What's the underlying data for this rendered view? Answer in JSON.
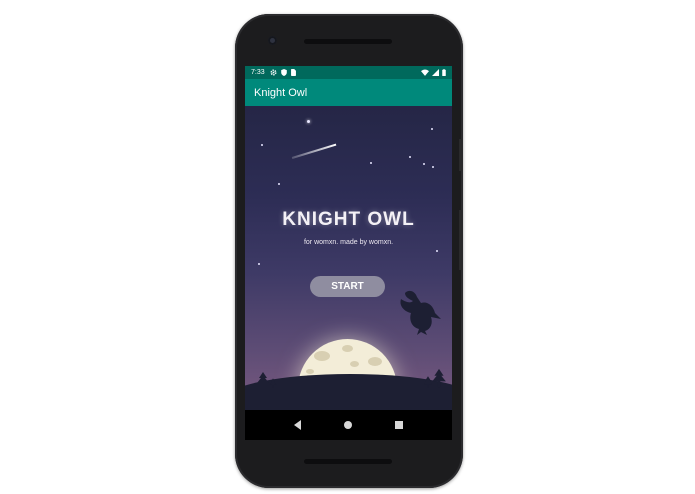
{
  "status_bar": {
    "time": "7:33",
    "icons_left": [
      "settings-icon",
      "shield-icon",
      "sim-icon"
    ],
    "icons_right": [
      "wifi-icon",
      "signal-icon",
      "battery-icon"
    ]
  },
  "app_bar": {
    "title": "Knight Owl"
  },
  "splash": {
    "title": "KNIGHT OWL",
    "tagline": "for womxn. made by womxn.",
    "start_label": "START"
  },
  "navigation": {
    "buttons": [
      "back",
      "home",
      "recents"
    ]
  },
  "colors": {
    "status_bar": "#00695c",
    "app_bar": "#00897b",
    "sky_top": "#252646",
    "sky_bottom": "#7a5a80",
    "start_button": "#8f8da0",
    "moon": "#f3edd8"
  }
}
